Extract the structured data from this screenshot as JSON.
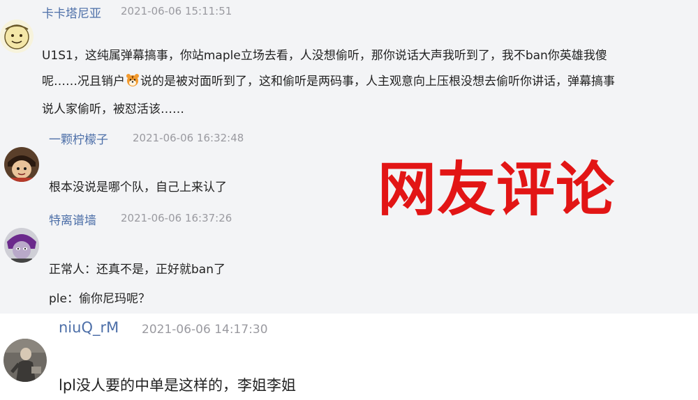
{
  "colors": {
    "username": "#4d6fa8",
    "timestamp": "#9a9aa0",
    "text": "#222222",
    "overlay": "#e21515",
    "top_background": "#f3f4f6",
    "bottom_background": "#ffffff"
  },
  "overlay": {
    "title": "网友评论"
  },
  "comments": [
    {
      "username": "卡卡塔尼亚",
      "timestamp": "2021-06-06 15:11:51",
      "avatar_icon": "cartoon-face-avatar",
      "lines": [
        "U1S1，这纯属弹幕搞事，你站maple立场去看，人没想偷听，那你说话大声我听到了，我不ban你英雄我傻",
        "呢……况且销户",
        "说的是被对面听到了，这和偷听是两码事，人主观意向上压根没想去偷听你讲话，弹幕搞事",
        "说人家偷听，被怼活该……"
      ],
      "emoji_icon": "tiger-face-emoji"
    },
    {
      "username": "一颗柠檬子",
      "timestamp": "2021-06-06 16:32:48",
      "avatar_icon": "anime-character-avatar",
      "lines": [
        "根本没说是哪个队，自己上来认了"
      ]
    },
    {
      "username": "特离谱墙",
      "timestamp": "2021-06-06 16:37:26",
      "avatar_icon": "purple-cartoon-avatar",
      "lines": [
        "正常人：还真不是，正好就ban了",
        "ple：偷你尼玛呢？"
      ]
    },
    {
      "username": "niuQ_rM",
      "timestamp": "2021-06-06 14:17:30",
      "avatar_icon": "figure-photo-avatar",
      "lines": [
        "lpl没人要的中单是这样的，李姐李姐"
      ]
    }
  ]
}
